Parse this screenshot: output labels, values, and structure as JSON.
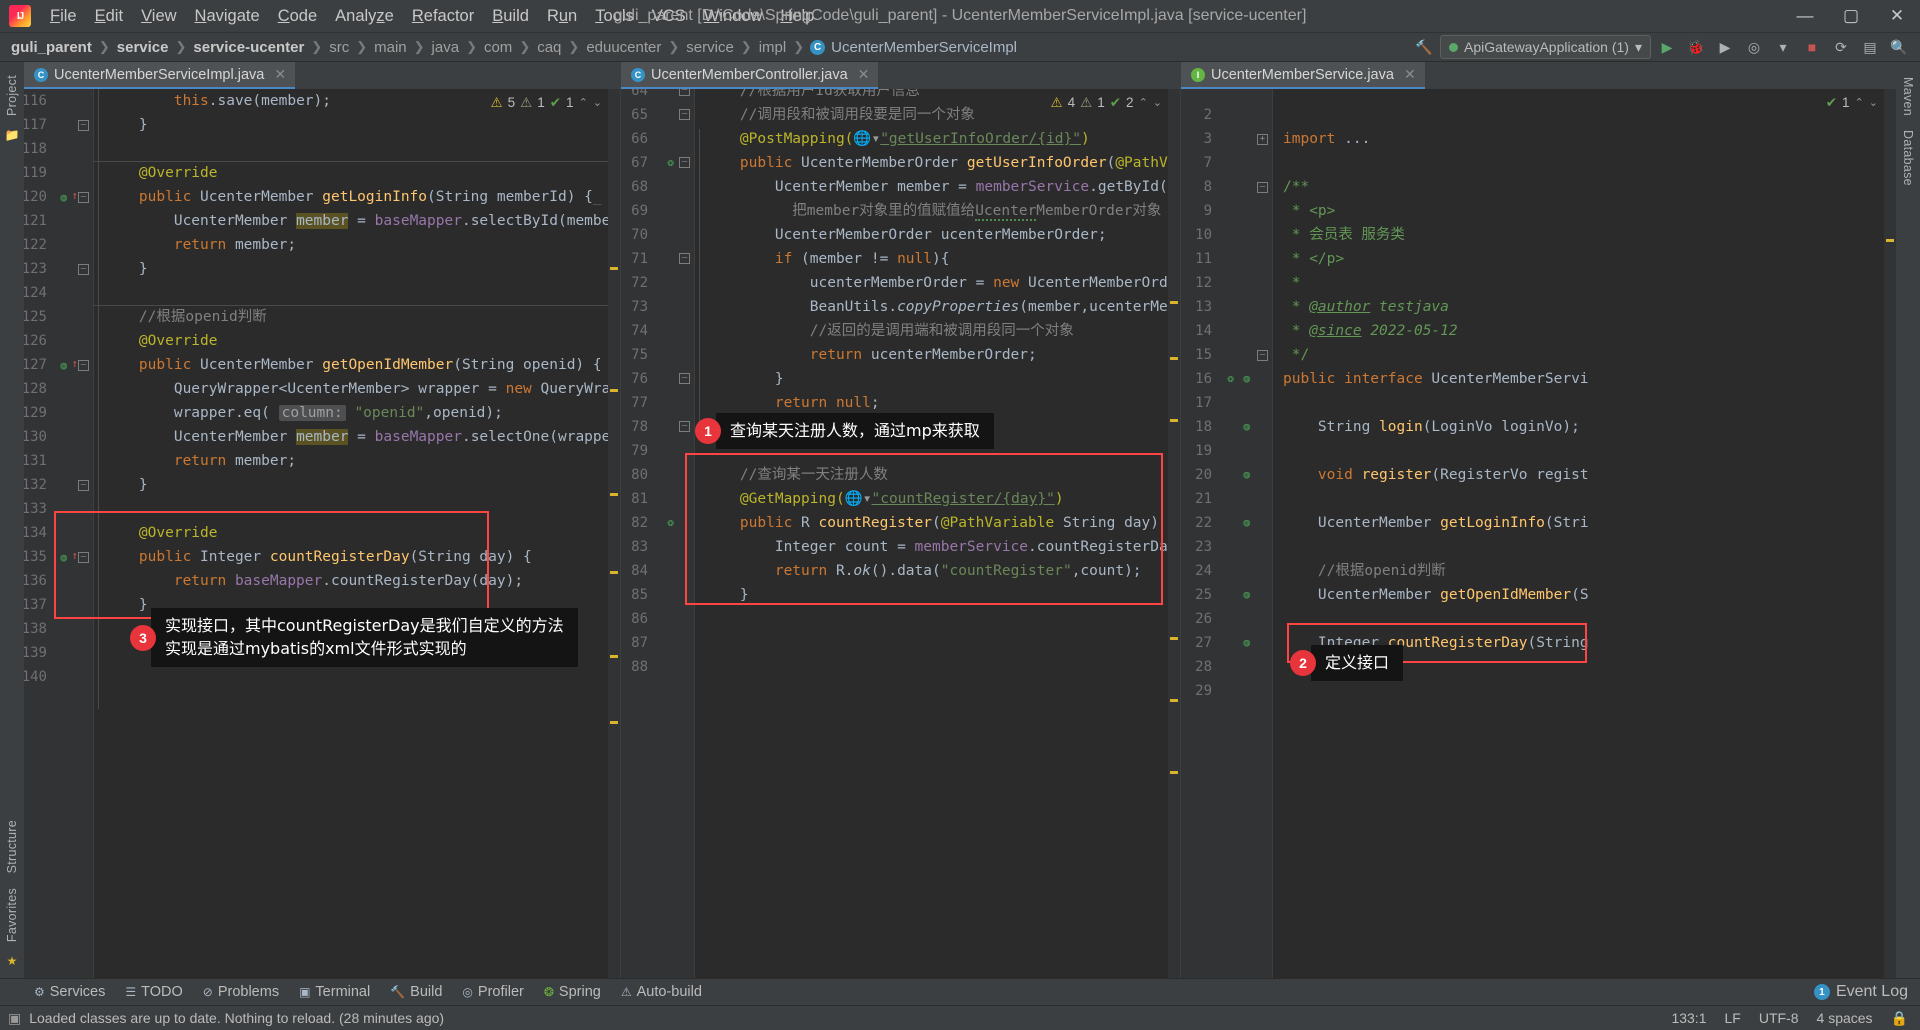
{
  "window": {
    "title": "guli_parent [D:\\Code\\SpringCode\\guli_parent] - UcenterMemberServiceImpl.java [service-ucenter]",
    "logo_text": "IJ",
    "minimize": "—",
    "maximize": "▢",
    "close": "✕"
  },
  "menu": [
    "File",
    "Edit",
    "View",
    "Navigate",
    "Code",
    "Analyze",
    "Refactor",
    "Build",
    "Run",
    "Tools",
    "VCS",
    "Window",
    "Help"
  ],
  "breadcrumb": [
    {
      "label": "guli_parent",
      "bold": true
    },
    {
      "label": "service",
      "bold": true
    },
    {
      "label": "service-ucenter",
      "bold": true
    },
    {
      "label": "src",
      "bold": false
    },
    {
      "label": "main",
      "bold": false
    },
    {
      "label": "java",
      "bold": false
    },
    {
      "label": "com",
      "bold": false
    },
    {
      "label": "caq",
      "bold": false
    },
    {
      "label": "eduucenter",
      "bold": false
    },
    {
      "label": "service",
      "bold": false
    },
    {
      "label": "impl",
      "bold": false
    },
    {
      "label": "UcenterMemberServiceImpl",
      "bold": false,
      "badge": "C"
    }
  ],
  "run_config": {
    "name": "ApiGatewayApplication (1)",
    "chevron": "▾"
  },
  "nav_icons": [
    "build-icon",
    "run-icon",
    "debug-icon",
    "coverage-icon",
    "profile-icon",
    "chevron-down-icon",
    "stop-icon",
    "layout-icon",
    "sidebar-icon",
    "search-icon"
  ],
  "tool_strips": {
    "left": [
      "Project",
      "Structure",
      "Favorites"
    ],
    "right": [
      "Maven",
      "Database"
    ]
  },
  "panes": [
    {
      "tab": {
        "label": "UcenterMemberServiceImpl.java",
        "badge": "C",
        "badge_kind": "class",
        "close": "✕"
      },
      "inspections": {
        "warnings": "5",
        "weak_warnings": "1",
        "checks": "1",
        "up": "⌃",
        "down": "⌄"
      },
      "first_line": 116,
      "lines": [
        {
          "n": 116,
          "t": "        this.save(member);"
        },
        {
          "n": 117,
          "t": "    }"
        },
        {
          "n": 118,
          "t": ""
        },
        {
          "n": 119,
          "t": "    @Override"
        },
        {
          "n": 120,
          "t": "    public UcenterMember getLoginInfo(String memberId) {"
        },
        {
          "n": 121,
          "t": "        UcenterMember member = baseMapper.selectById(membe"
        },
        {
          "n": 122,
          "t": "        return member;"
        },
        {
          "n": 123,
          "t": "    }"
        },
        {
          "n": 124,
          "t": ""
        },
        {
          "n": 125,
          "t": "    //根据openid判断"
        },
        {
          "n": 126,
          "t": "    @Override"
        },
        {
          "n": 127,
          "t": "    public UcenterMember getOpenIdMember(String openid) {"
        },
        {
          "n": 128,
          "t": "        QueryWrapper<UcenterMember> wrapper = new QueryWra"
        },
        {
          "n": 129,
          "t": "        wrapper.eq( column: \"openid\",openid);"
        },
        {
          "n": 130,
          "t": "        UcenterMember member = baseMapper.selectOne(wrappe"
        },
        {
          "n": 131,
          "t": "        return member;"
        },
        {
          "n": 132,
          "t": "    }"
        },
        {
          "n": 133,
          "t": ""
        },
        {
          "n": 134,
          "t": "    @Override"
        },
        {
          "n": 135,
          "t": "    public Integer countRegisterDay(String day) {"
        },
        {
          "n": 136,
          "t": "        return baseMapper.countRegisterDay(day);"
        },
        {
          "n": 137,
          "t": "    }"
        },
        {
          "n": 138,
          "t": ""
        },
        {
          "n": 139,
          "t": ""
        },
        {
          "n": 140,
          "t": ""
        }
      ]
    },
    {
      "tab": {
        "label": "UcenterMemberController.java",
        "badge": "C",
        "badge_kind": "class",
        "close": "✕"
      },
      "inspections": {
        "warnings": "4",
        "weak_warnings": "1",
        "checks": "2",
        "up": "⌃",
        "down": "⌄"
      },
      "first_line": 64,
      "lines": [
        {
          "n": 64,
          "t": "    //根据用户Id获取用户信息"
        },
        {
          "n": 65,
          "t": "    //调用段和被调用段要是同一个对象"
        },
        {
          "n": 66,
          "t": "    @PostMapping(\"getUserInfoOrder/{id}\")"
        },
        {
          "n": 67,
          "t": "    public UcenterMemberOrder getUserInfoOrder(@PathVariab"
        },
        {
          "n": 68,
          "t": "        UcenterMember member = memberService.getById(id);"
        },
        {
          "n": 69,
          "t": "        把member对象里的值赋值给UcenterMemberOrder对象"
        },
        {
          "n": 70,
          "t": "        UcenterMemberOrder ucenterMemberOrder;"
        },
        {
          "n": 71,
          "t": "        if (member != null){"
        },
        {
          "n": 72,
          "t": "            ucenterMemberOrder = new UcenterMemberOrder();"
        },
        {
          "n": 73,
          "t": "            BeanUtils.copyProperties(member,ucenterMemberO"
        },
        {
          "n": 74,
          "t": "            //返回的是调用端和被调用段同一个对象"
        },
        {
          "n": 75,
          "t": "            return ucenterMemberOrder;"
        },
        {
          "n": 76,
          "t": "        }"
        },
        {
          "n": 77,
          "t": "        return null;"
        },
        {
          "n": 78,
          "t": "    }"
        },
        {
          "n": 79,
          "t": ""
        },
        {
          "n": 80,
          "t": "    //查询某一天注册人数"
        },
        {
          "n": 81,
          "t": "    @GetMapping(\"countRegister/{day}\")"
        },
        {
          "n": 82,
          "t": "    public R countRegister(@PathVariable String day) {"
        },
        {
          "n": 83,
          "t": "        Integer count = memberService.countRegisterDay(da"
        },
        {
          "n": 84,
          "t": "        return R.ok().data(\"countRegister\",count);"
        },
        {
          "n": 85,
          "t": "    }"
        },
        {
          "n": 86,
          "t": ""
        },
        {
          "n": 87,
          "t": ""
        },
        {
          "n": 88,
          "t": ""
        }
      ]
    },
    {
      "tab": {
        "label": "UcenterMemberService.java",
        "badge": "I",
        "badge_kind": "interface",
        "close": "✕"
      },
      "inspections": {
        "checks": "1",
        "up": "⌃",
        "down": "⌄"
      },
      "first_line": 2,
      "lines": [
        {
          "n": 2,
          "t": ""
        },
        {
          "n": 3,
          "t": "import ..."
        },
        {
          "n": 7,
          "t": ""
        },
        {
          "n": 8,
          "t": "/**"
        },
        {
          "n": 9,
          "t": " * <p>"
        },
        {
          "n": 10,
          "t": " * 会员表 服务类"
        },
        {
          "n": 11,
          "t": " * </p>"
        },
        {
          "n": 12,
          "t": " *"
        },
        {
          "n": 13,
          "t": " * @author testjava"
        },
        {
          "n": 14,
          "t": " * @since 2022-05-12"
        },
        {
          "n": 15,
          "t": " */"
        },
        {
          "n": 16,
          "t": "public interface UcenterMemberServi"
        },
        {
          "n": 17,
          "t": ""
        },
        {
          "n": 18,
          "t": "    String login(LoginVo loginVo);"
        },
        {
          "n": 19,
          "t": ""
        },
        {
          "n": 20,
          "t": "    void register(RegisterVo regist"
        },
        {
          "n": 21,
          "t": ""
        },
        {
          "n": 22,
          "t": "    UcenterMember getLoginInfo(Stri"
        },
        {
          "n": 23,
          "t": ""
        },
        {
          "n": 24,
          "t": "    //根据openid判断"
        },
        {
          "n": 25,
          "t": "    UcenterMember getOpenIdMember(S"
        },
        {
          "n": 26,
          "t": ""
        },
        {
          "n": 27,
          "t": "    Integer countRegisterDay(String"
        },
        {
          "n": 28,
          "t": "}"
        },
        {
          "n": 29,
          "t": ""
        }
      ]
    }
  ],
  "annotations": [
    {
      "num": "1",
      "text": "查询某天注册人数，通过mp来获取"
    },
    {
      "num": "2",
      "text": "定义接口"
    },
    {
      "num": "3",
      "text": "实现接口，其中countRegisterDay是我们自定义的方法\n实现是通过mybatis的xml文件形式实现的"
    }
  ],
  "bottom_toolbar": {
    "items": [
      {
        "icon": "services-icon",
        "label": "Services"
      },
      {
        "icon": "todo-icon",
        "label": "TODO"
      },
      {
        "icon": "problems-icon",
        "label": "Problems"
      },
      {
        "icon": "terminal-icon",
        "label": "Terminal"
      },
      {
        "icon": "build-icon",
        "label": "Build"
      },
      {
        "icon": "profiler-icon",
        "label": "Profiler"
      },
      {
        "icon": "spring-icon",
        "label": "Spring"
      },
      {
        "icon": "autobuild-icon",
        "label": "Auto-build"
      }
    ],
    "event_log": {
      "count": "1",
      "label": "Event Log"
    }
  },
  "status_bar": {
    "message": "Loaded classes are up to date. Nothing to reload. (28 minutes ago)",
    "caret": "133:1",
    "line_sep": "LF",
    "encoding": "UTF-8",
    "indent": "4 spaces"
  },
  "colors": {
    "accent": "#4a88c7",
    "annotation_red": "#e8353c",
    "redbox": "#ff4444",
    "editor_bg": "#2b2b2b",
    "chrome_bg": "#3c3f41",
    "gutter_bg": "#313335"
  }
}
